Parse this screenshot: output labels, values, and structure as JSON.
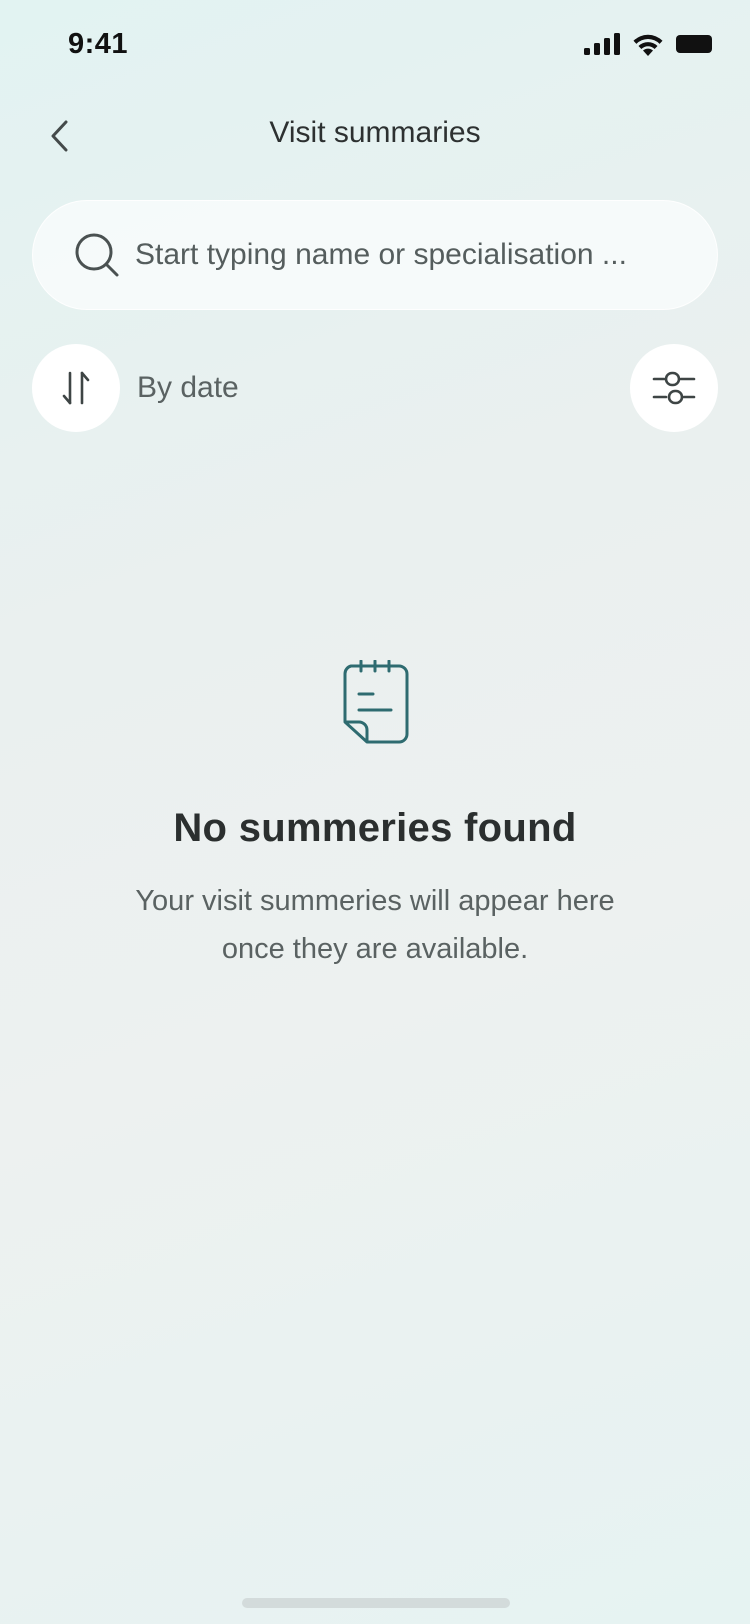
{
  "status_bar": {
    "time": "9:41",
    "icons": [
      "cellular-signal-icon",
      "wifi-icon",
      "battery-icon"
    ]
  },
  "header": {
    "back_icon": "chevron-left-icon",
    "title": "Visit summaries"
  },
  "search": {
    "icon": "search-icon",
    "placeholder": "Start typing name or specialisation ...",
    "value": ""
  },
  "sort": {
    "icon": "sort-arrows-icon",
    "label": "By date"
  },
  "filter": {
    "icon": "sliders-icon"
  },
  "empty_state": {
    "icon": "note-document-icon",
    "title": "No summeries found",
    "line1": "Your visit summeries will appear here",
    "line2": "once they are available."
  },
  "colors": {
    "accent": "#2e6b70",
    "background": "#eaf1f0",
    "text_primary": "#2b2f2f",
    "text_secondary": "#5a6262"
  }
}
